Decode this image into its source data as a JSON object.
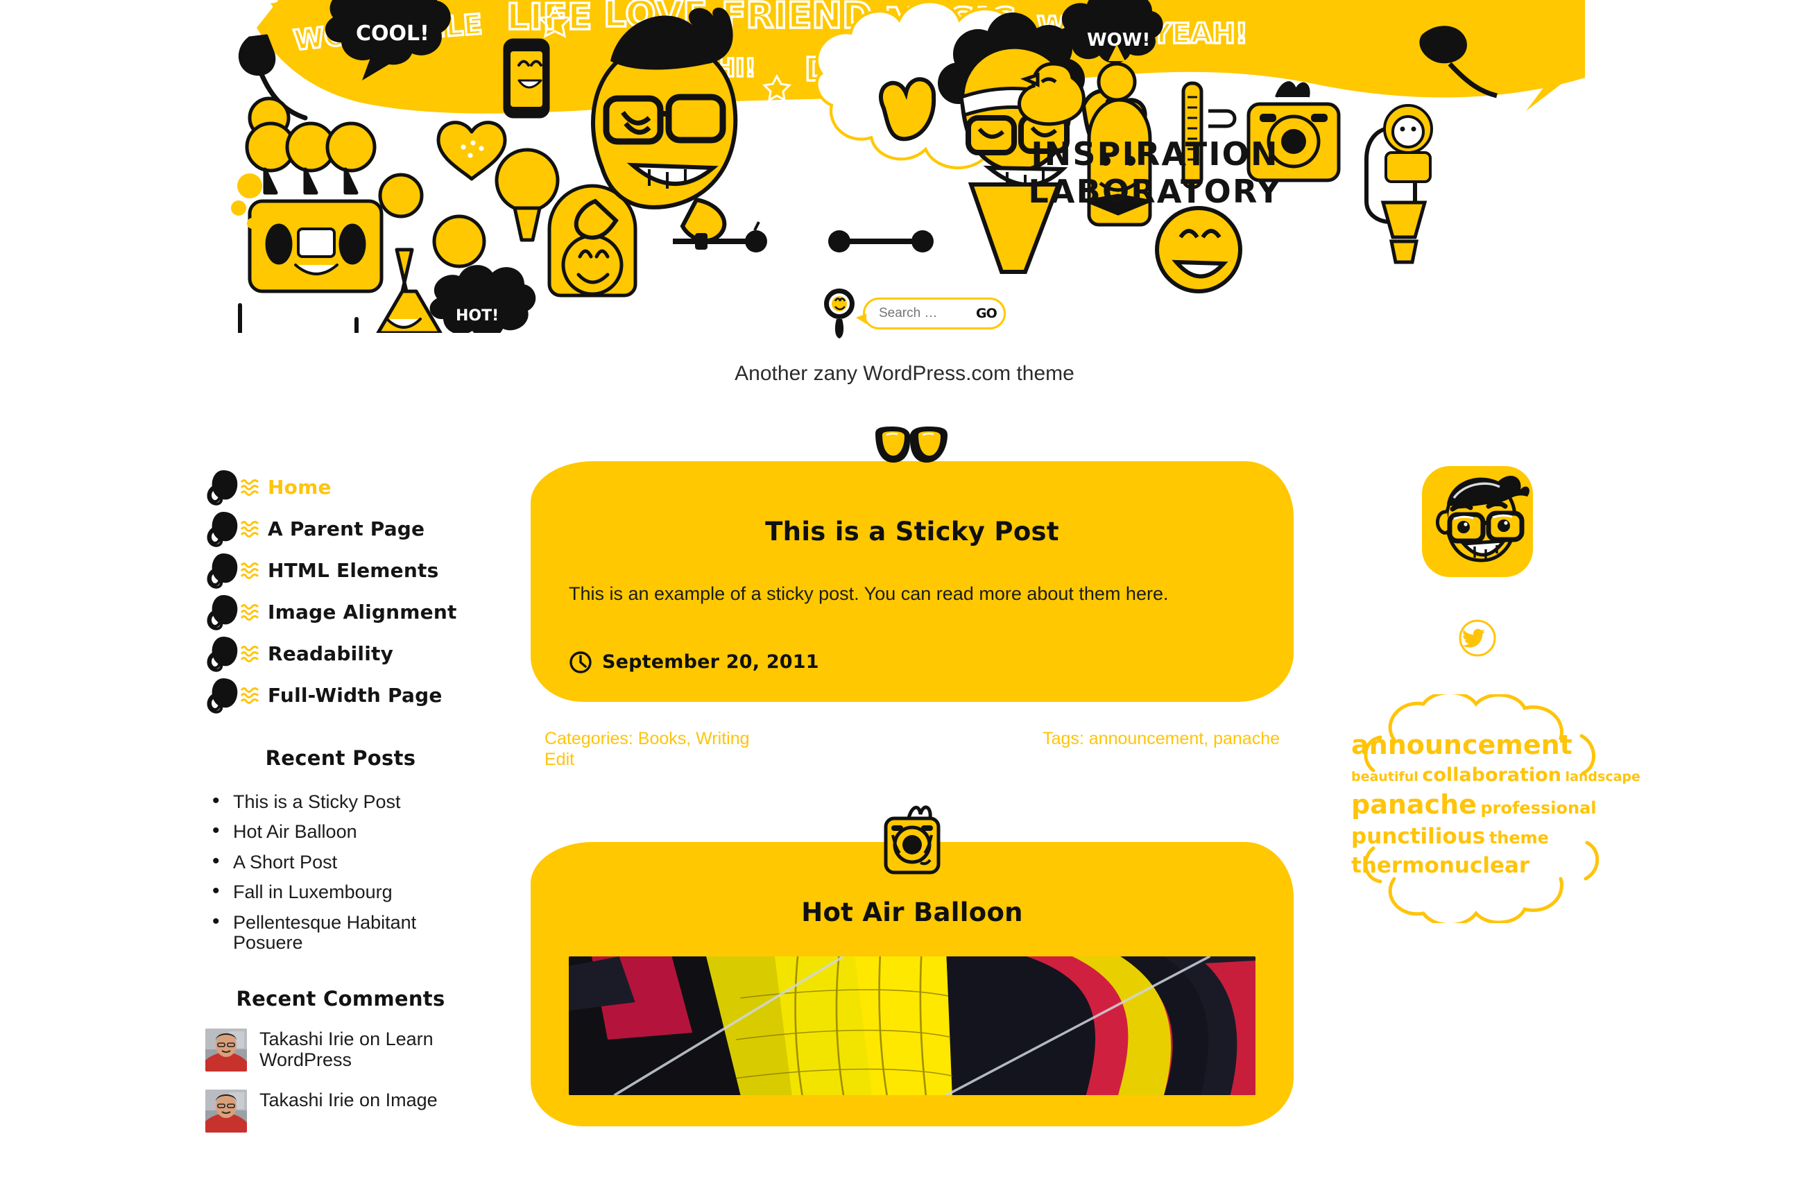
{
  "header": {
    "site_title_line1": "INSPIRATION",
    "site_title_line2": "LABORATORY",
    "tagline": "Another zany WordPress.com theme",
    "banner_words": [
      "WOW!",
      "SMILE",
      "LIFE",
      "LOVE",
      "FRIEND",
      "MUSIC",
      "WOW!",
      "YEAH!",
      "ART",
      "HI!",
      "DREAM"
    ],
    "speech_cool": "COOL!",
    "speech_hot": "HOT!",
    "speech_wow": "WOW!",
    "accent_yellow": "#FFC800",
    "link_yellow": "#FFC40A",
    "ink_black": "#131313"
  },
  "search": {
    "placeholder": "Search …",
    "value": "",
    "go_label": "GO",
    "icon": "search-icon"
  },
  "sidebar_left": {
    "nav": [
      {
        "label": "Home",
        "active": true
      },
      {
        "label": "A Parent Page",
        "active": false
      },
      {
        "label": "HTML Elements",
        "active": false
      },
      {
        "label": "Image Alignment",
        "active": false
      },
      {
        "label": "Readability",
        "active": false
      },
      {
        "label": "Full-Width Page",
        "active": false
      }
    ],
    "recent_posts": {
      "title": "Recent Posts",
      "items": [
        "This is a Sticky Post",
        "Hot Air Balloon",
        "A Short Post",
        "Fall in Luxembourg",
        "Pellentesque Habitant Posuere"
      ]
    },
    "recent_comments": {
      "title": "Recent Comments",
      "items": [
        "Takashi Irie on Learn WordPress",
        "Takashi Irie on Image"
      ]
    }
  },
  "main": {
    "posts": [
      {
        "badge_icon": "glasses-icon",
        "title": "This is a Sticky Post",
        "body": "This is an example of a sticky post. You can read more about them here.",
        "date_icon": "clock-icon",
        "date": "September 20, 2011",
        "categories_label": "Categories: Books, Writing",
        "edit_label": "Edit",
        "tags_label": "Tags: announcement, panache"
      },
      {
        "badge_icon": "camera-icon",
        "title": "Hot Air Balloon",
        "body": "",
        "date_icon": "clock-icon",
        "date": "",
        "categories_label": "",
        "edit_label": "",
        "tags_label": ""
      }
    ]
  },
  "sidebar_right": {
    "avatar_icon": "author-face-avatar",
    "social": [
      {
        "name": "twitter-icon",
        "label": "Twitter"
      }
    ],
    "tag_cloud": [
      {
        "text": "announcement",
        "size": 38
      },
      {
        "text": "beautiful",
        "size": 19
      },
      {
        "text": "collaboration",
        "size": 27
      },
      {
        "text": "landscape",
        "size": 19
      },
      {
        "text": "panache",
        "size": 38
      },
      {
        "text": "professional",
        "size": 24
      },
      {
        "text": "punctilious",
        "size": 31
      },
      {
        "text": "theme",
        "size": 24
      },
      {
        "text": "thermonuclear",
        "size": 31
      }
    ]
  }
}
